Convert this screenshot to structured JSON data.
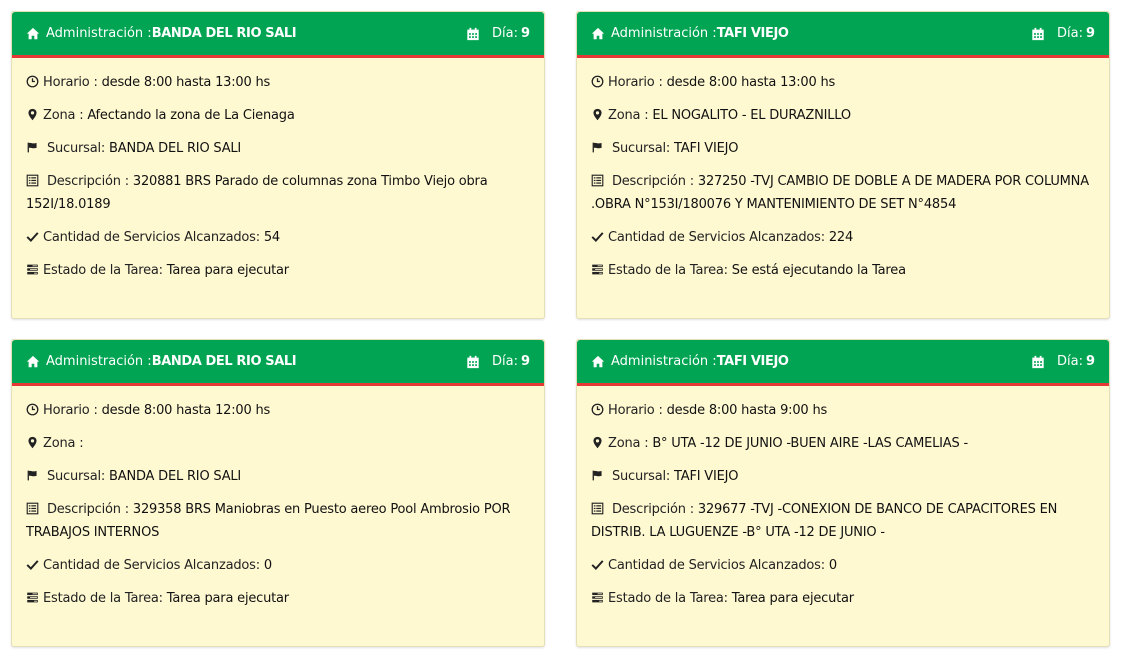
{
  "cards": [
    {
      "header": {
        "admin_label": "Administración :",
        "admin_name": "BANDA DEL RIO SALI",
        "day_label": "Día:",
        "day_value": "9"
      },
      "horario": {
        "label": "Horario :",
        "value": "desde 8:00 hasta 13:00 hs"
      },
      "zona": {
        "label": "Zona :",
        "value": "Afectando la zona de La Cienaga"
      },
      "sucursal": {
        "label": "Sucursal:",
        "value": "BANDA DEL RIO SALI"
      },
      "descripcion": {
        "label": "Descripción :",
        "value": "320881 BRS Parado de columnas zona Timbo Viejo obra 152I/18.0189"
      },
      "cantidad": {
        "label": "Cantidad de Servicios Alcanzados:",
        "value": "54"
      },
      "estado": {
        "label": "Estado de la Tarea:",
        "value": "Tarea para ejecutar"
      }
    },
    {
      "header": {
        "admin_label": "Administración :",
        "admin_name": "TAFI VIEJO",
        "day_label": "Día:",
        "day_value": "9"
      },
      "horario": {
        "label": "Horario :",
        "value": "desde 8:00 hasta 13:00 hs"
      },
      "zona": {
        "label": "Zona :",
        "value": "EL NOGALITO - EL DURAZNILLO"
      },
      "sucursal": {
        "label": "Sucursal:",
        "value": "TAFI VIEJO"
      },
      "descripcion": {
        "label": "Descripción :",
        "value": "327250 -TVJ CAMBIO DE DOBLE A DE MADERA POR COLUMNA .OBRA N°153I/180076 Y MANTENIMIENTO DE SET N°4854"
      },
      "cantidad": {
        "label": "Cantidad de Servicios Alcanzados:",
        "value": "224"
      },
      "estado": {
        "label": "Estado de la Tarea:",
        "value": "Se está ejecutando la Tarea"
      }
    },
    {
      "header": {
        "admin_label": "Administración :",
        "admin_name": "BANDA DEL RIO SALI",
        "day_label": "Día:",
        "day_value": "9"
      },
      "horario": {
        "label": "Horario :",
        "value": "desde 8:00 hasta 12:00 hs"
      },
      "zona": {
        "label": "Zona :",
        "value": ""
      },
      "sucursal": {
        "label": "Sucursal:",
        "value": "BANDA DEL RIO SALI"
      },
      "descripcion": {
        "label": "Descripción :",
        "value": "329358 BRS Maniobras en Puesto aereo Pool Ambrosio POR TRABAJOS INTERNOS"
      },
      "cantidad": {
        "label": "Cantidad de Servicios Alcanzados:",
        "value": "0"
      },
      "estado": {
        "label": "Estado de la Tarea:",
        "value": "Tarea para ejecutar"
      }
    },
    {
      "header": {
        "admin_label": "Administración :",
        "admin_name": "TAFI VIEJO",
        "day_label": "Día:",
        "day_value": "9"
      },
      "horario": {
        "label": "Horario :",
        "value": "desde 8:00 hasta 9:00 hs"
      },
      "zona": {
        "label": "Zona :",
        "value": "B° UTA -12 DE JUNIO -BUEN AIRE -LAS CAMELIAS -"
      },
      "sucursal": {
        "label": "Sucursal:",
        "value": "TAFI VIEJO"
      },
      "descripcion": {
        "label": "Descripción :",
        "value": "329677 -TVJ -CONEXION DE BANCO DE CAPACITORES EN DISTRIB. LA LUGUENZE -B° UTA -12 DE JUNIO -"
      },
      "cantidad": {
        "label": "Cantidad de Servicios Alcanzados:",
        "value": "0"
      },
      "estado": {
        "label": "Estado de la Tarea:",
        "value": "Tarea para ejecutar"
      }
    }
  ],
  "icons": {
    "header_left": "home-icon",
    "header_right": "calendar-icon",
    "horario": "clock-icon",
    "zona": "map-marker-icon",
    "sucursal": "flag-icon",
    "descripcion": "list-alt-icon",
    "cantidad": "check-icon",
    "estado": "tasks-icon"
  },
  "colors": {
    "header_bg": "#00a452",
    "header_border": "#e53935",
    "card_bg": "#fff9d2"
  }
}
